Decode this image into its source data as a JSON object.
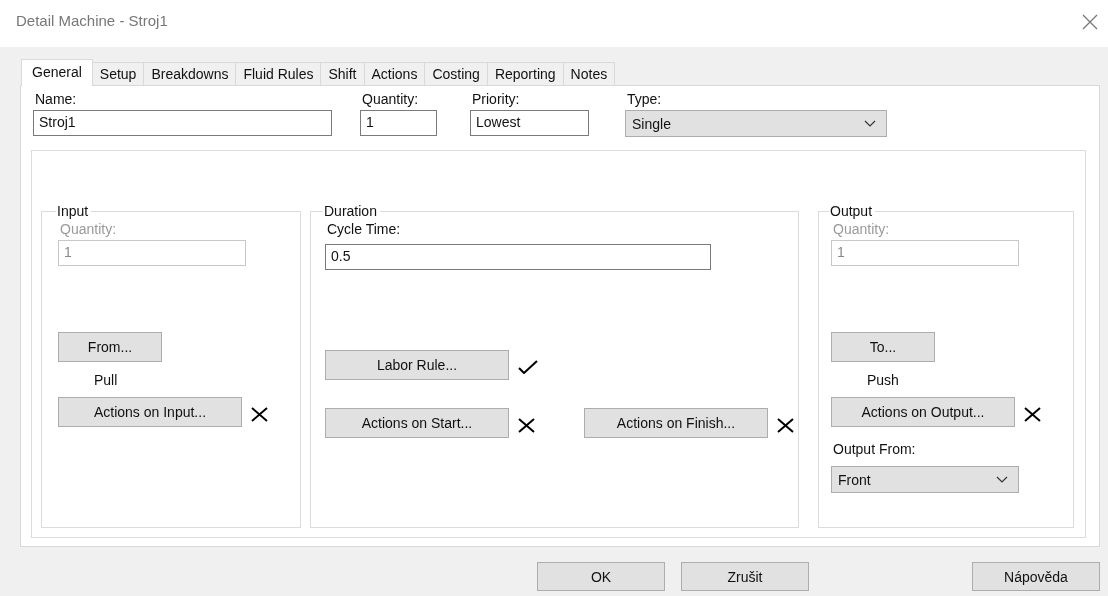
{
  "window": {
    "title": "Detail Machine - Stroj1"
  },
  "tabs": [
    {
      "label": "General",
      "selected": true
    },
    {
      "label": "Setup",
      "selected": false
    },
    {
      "label": "Breakdowns",
      "selected": false
    },
    {
      "label": "Fluid Rules",
      "selected": false
    },
    {
      "label": "Shift",
      "selected": false
    },
    {
      "label": "Actions",
      "selected": false
    },
    {
      "label": "Costing",
      "selected": false
    },
    {
      "label": "Reporting",
      "selected": false
    },
    {
      "label": "Notes",
      "selected": false
    }
  ],
  "fields": {
    "name": {
      "label": "Name:",
      "value": "Stroj1"
    },
    "quantity": {
      "label": "Quantity:",
      "value": "1"
    },
    "priority": {
      "label": "Priority:",
      "value": "Lowest"
    },
    "type": {
      "label": "Type:",
      "value": "Single"
    }
  },
  "input": {
    "title": "Input",
    "quantity_label": "Quantity:",
    "quantity_value": "1",
    "disabled": true,
    "route_button": "From...",
    "route_mode": "Pull",
    "actions_button": "Actions on Input...",
    "actions_set": false
  },
  "duration": {
    "title": "Duration",
    "cycle_label": "Cycle Time:",
    "cycle_value": "0.5",
    "labor_button": "Labor Rule...",
    "labor_set": true,
    "start_button": "Actions on Start...",
    "start_set": false,
    "finish_button": "Actions on Finish...",
    "finish_set": false
  },
  "output": {
    "title": "Output",
    "quantity_label": "Quantity:",
    "quantity_value": "1",
    "disabled": true,
    "route_button": "To...",
    "route_mode": "Push",
    "actions_button": "Actions on Output...",
    "actions_set": false,
    "from_label": "Output From:",
    "from_value": "Front"
  },
  "buttons": [
    {
      "label": "OK"
    },
    {
      "label": "Zrušit"
    },
    {
      "label": "Nápověda"
    }
  ]
}
